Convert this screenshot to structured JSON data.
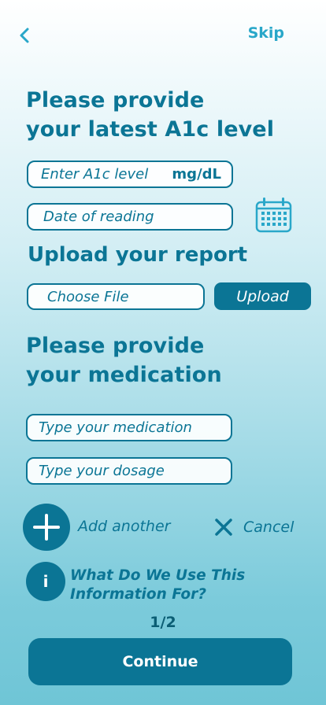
{
  "header": {
    "back_icon": "chevron-left-icon",
    "skip_label": "Skip"
  },
  "a1c": {
    "heading_line1": "Please provide",
    "heading_line2": "your latest A1c level",
    "level_placeholder": "Enter A1c level",
    "unit": "mg/dL",
    "date_placeholder": "Date of reading",
    "calendar_icon": "calendar-icon"
  },
  "report": {
    "heading": "Upload your report",
    "choose_file_label": "Choose File",
    "upload_label": "Upload"
  },
  "medication": {
    "heading_line1": "Please provide",
    "heading_line2": "your medication",
    "medication_placeholder": "Type your medication",
    "dosage_placeholder": "Type your dosage",
    "add_label": "Add another",
    "cancel_label": "Cancel"
  },
  "info": {
    "icon_text": "i",
    "text": "What Do We Use This Information For?"
  },
  "footer": {
    "page_indicator": "1/2",
    "continue_label": "Continue"
  },
  "colors": {
    "primary": "#0b7595",
    "accent": "#29a7c9",
    "gradient_top": "#ffffff",
    "gradient_bottom": "#6fc5d6"
  }
}
